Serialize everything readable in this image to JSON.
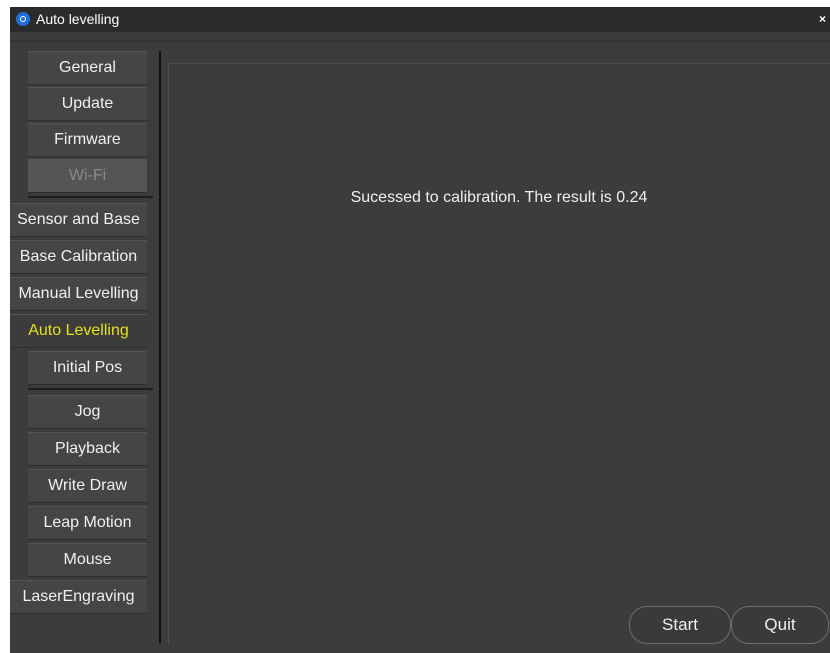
{
  "window": {
    "title": "Auto levelling",
    "close_label": "×"
  },
  "sidebar": {
    "groups": [
      {
        "items": [
          {
            "label": "General"
          },
          {
            "label": "Update"
          },
          {
            "label": "Firmware"
          },
          {
            "label": "Wi-Fi",
            "state": "disabled"
          }
        ]
      },
      {
        "items": [
          {
            "label": "Sensor and Base"
          },
          {
            "label": "Base Calibration"
          },
          {
            "label": "Manual Levelling"
          },
          {
            "label": "Auto Levelling",
            "state": "active"
          },
          {
            "label": "Initial Pos"
          }
        ]
      },
      {
        "items": [
          {
            "label": "Jog"
          },
          {
            "label": "Playback"
          },
          {
            "label": "Write  Draw"
          },
          {
            "label": "Leap Motion"
          },
          {
            "label": "Mouse"
          },
          {
            "label": "LaserEngraving"
          }
        ]
      }
    ]
  },
  "main": {
    "message": "Sucessed to calibration. The result is 0.24"
  },
  "buttons": {
    "start": "Start",
    "quit": "Quit"
  },
  "colors": {
    "active_text": "#e6e017",
    "background": "#3c3c3c",
    "titlebar": "#2b2b2b"
  }
}
